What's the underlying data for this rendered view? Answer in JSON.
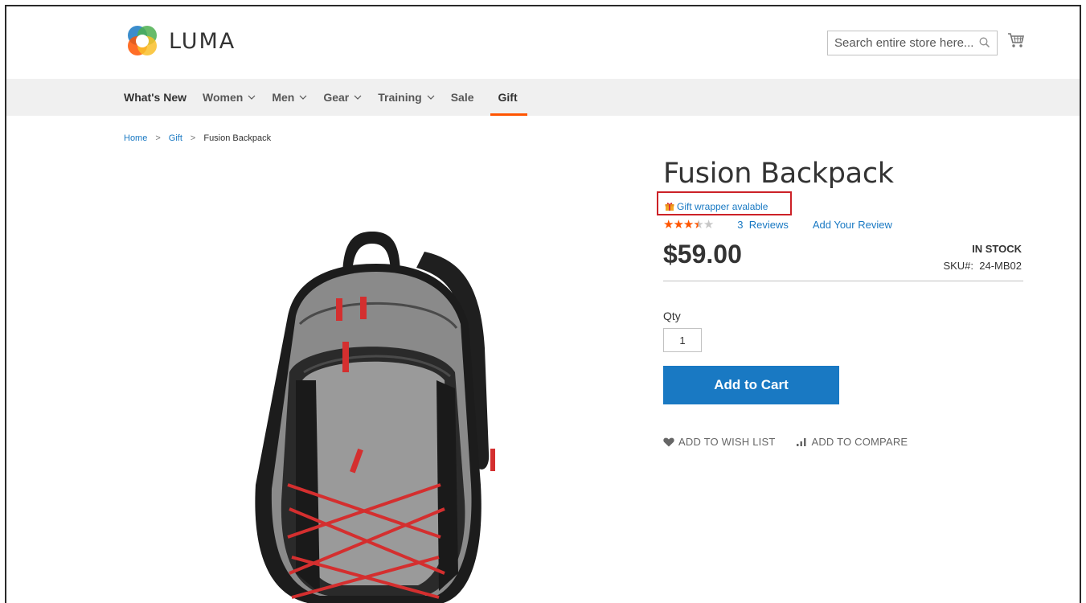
{
  "header": {
    "logo_text": "LUMA",
    "search_placeholder": "Search entire store here..."
  },
  "nav": {
    "items": [
      {
        "label": "What's New",
        "has_dropdown": false
      },
      {
        "label": "Women",
        "has_dropdown": true
      },
      {
        "label": "Men",
        "has_dropdown": true
      },
      {
        "label": "Gear",
        "has_dropdown": true
      },
      {
        "label": "Training",
        "has_dropdown": true
      },
      {
        "label": "Sale",
        "has_dropdown": false
      },
      {
        "label": "Gift",
        "has_dropdown": false,
        "active": true
      }
    ]
  },
  "breadcrumb": {
    "home": "Home",
    "gift": "Gift",
    "current": "Fusion Backpack",
    "separator": ">"
  },
  "product": {
    "title": "Fusion Backpack",
    "gift_wrapper_text": "Gift wrapper avalable",
    "rating_stars": 3.5,
    "rating_max": 5,
    "reviews_link": "3  Reviews",
    "add_review_link": "Add Your Review",
    "price": "$59.00",
    "stock_status": "IN STOCK",
    "sku_label": "SKU#:",
    "sku_value": "24-MB02",
    "qty_label": "Qty",
    "qty_value": "1",
    "add_to_cart_label": "Add to Cart",
    "wishlist_label": "ADD TO WISH LIST",
    "compare_label": "ADD TO COMPARE"
  },
  "colors": {
    "accent_orange": "#ff5501",
    "link_blue": "#1979c3",
    "highlight_red": "#cc2127",
    "nav_bg": "#f0f0f0"
  }
}
